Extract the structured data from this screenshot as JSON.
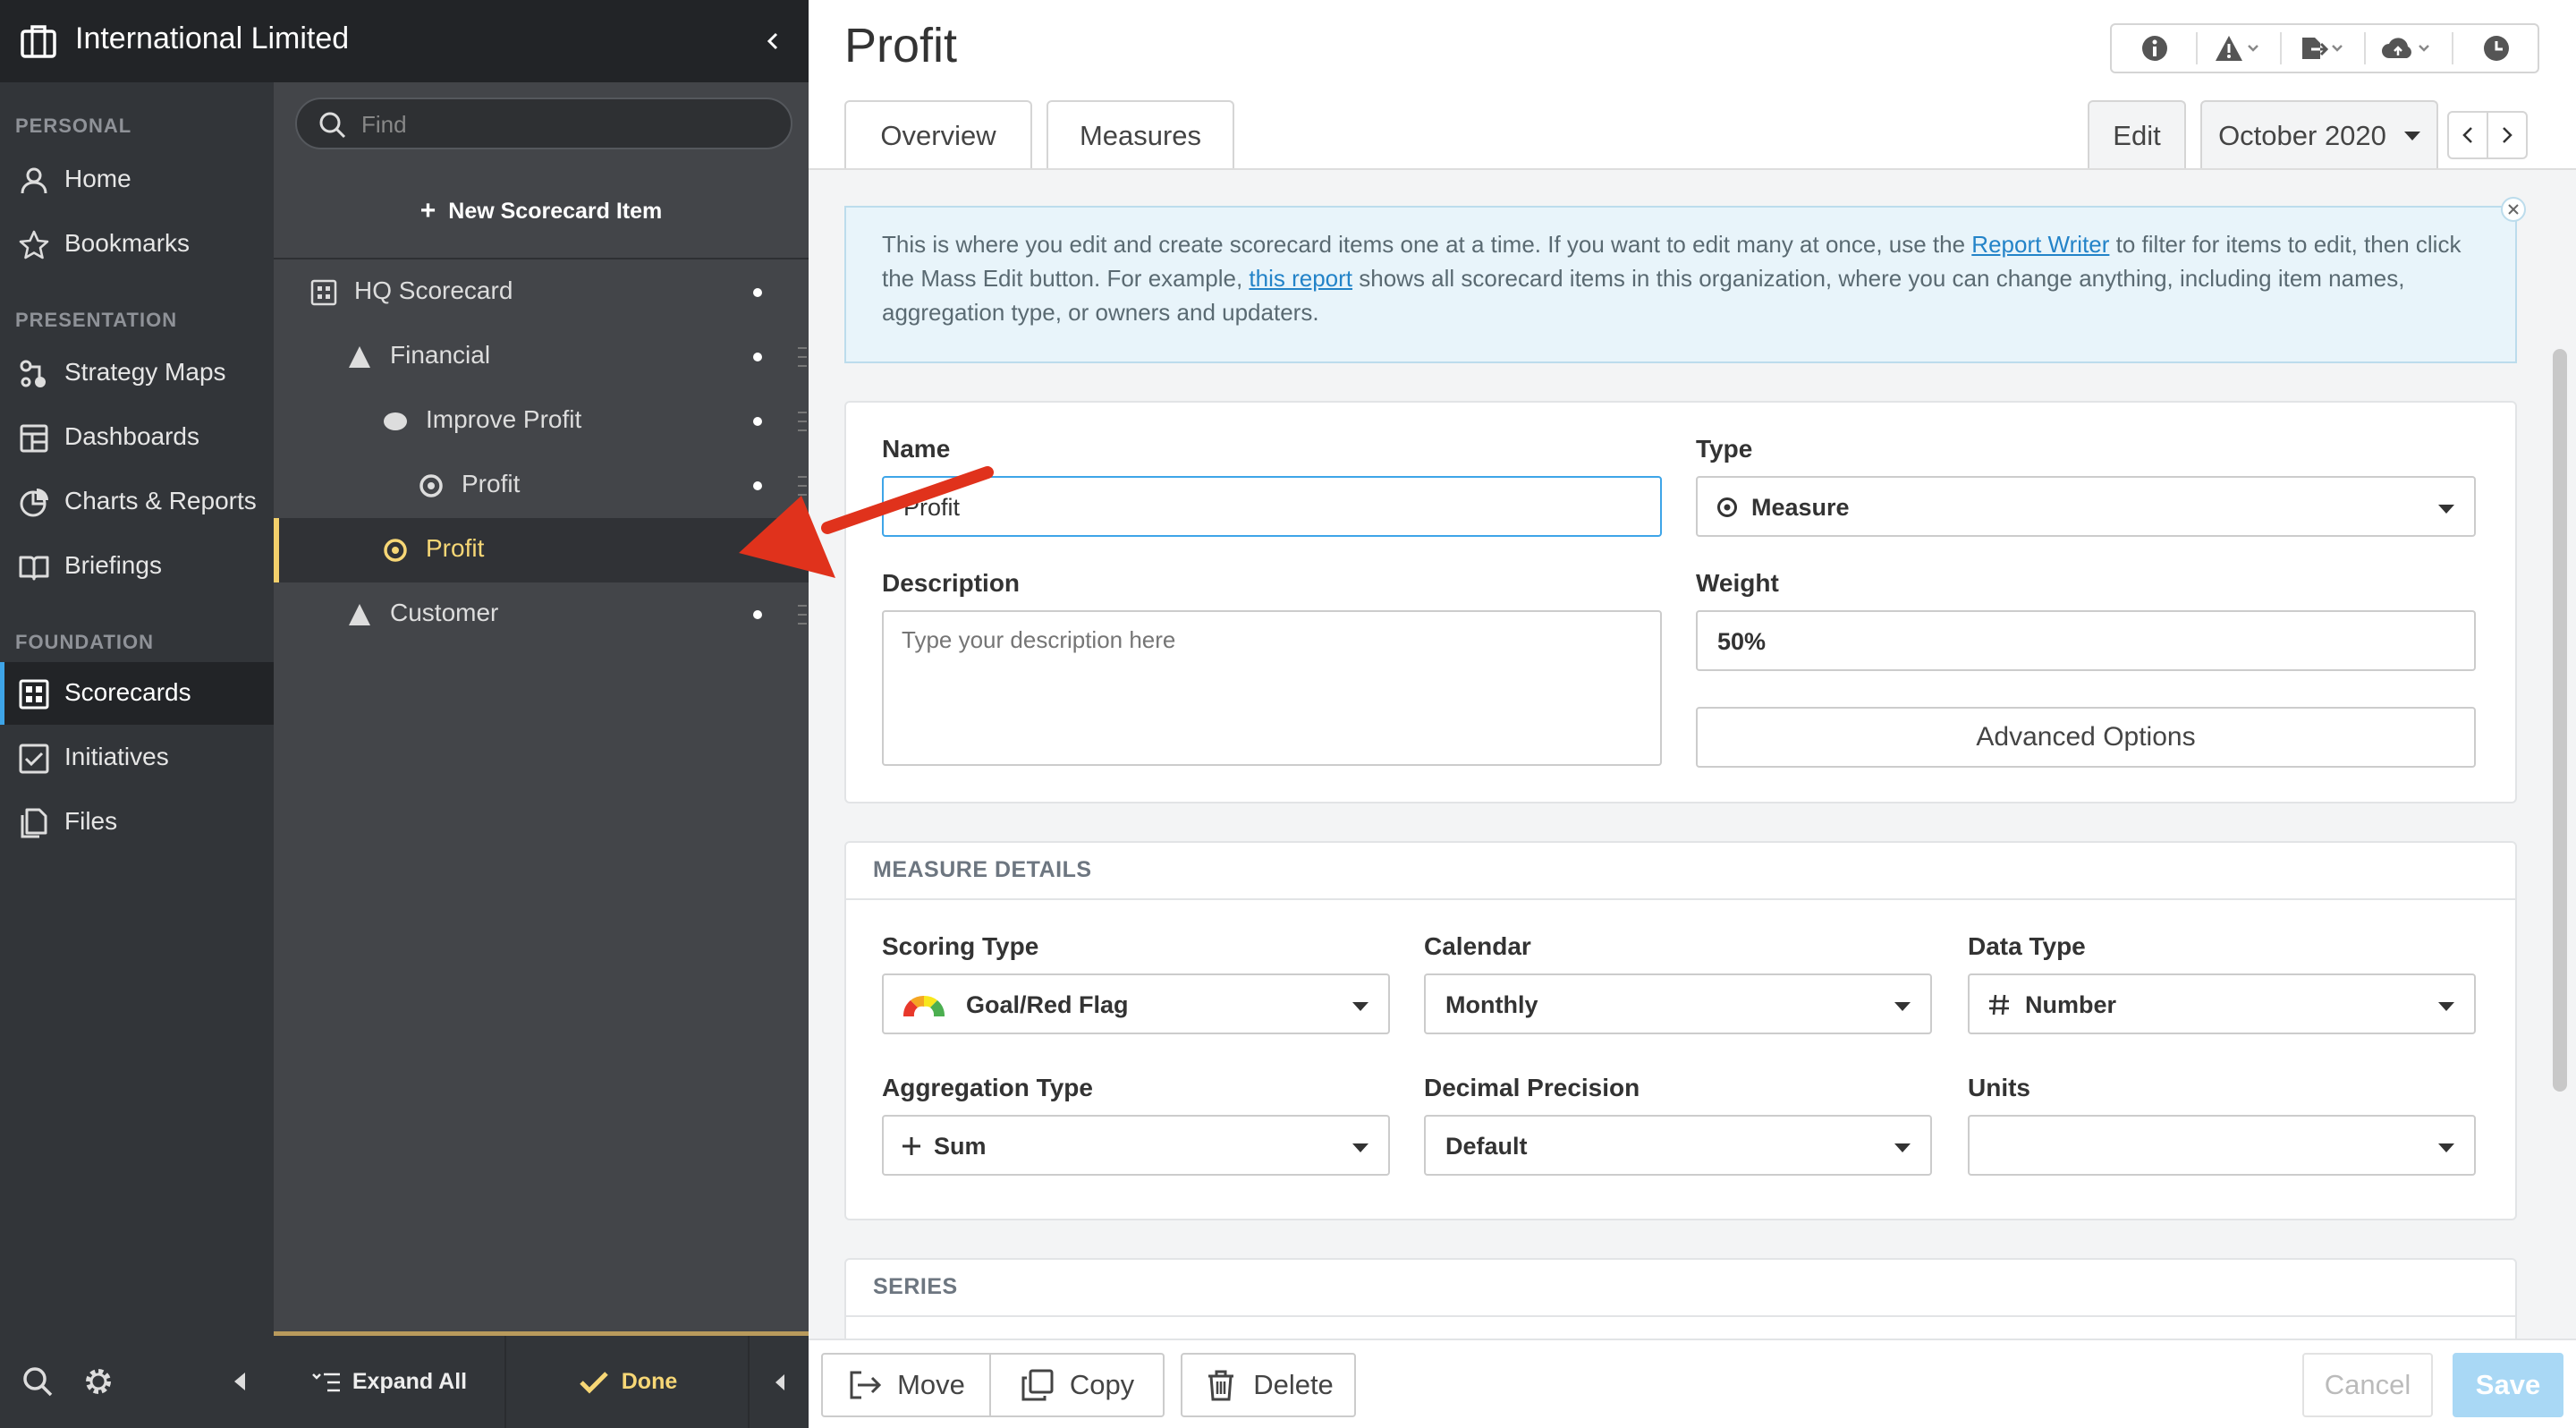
{
  "app": {
    "org_name": "International Limited"
  },
  "sidebar": {
    "sections": [
      {
        "title": "PERSONAL",
        "items": [
          {
            "label": "Home",
            "icon": "user-icon"
          },
          {
            "label": "Bookmarks",
            "icon": "star-icon"
          }
        ]
      },
      {
        "title": "PRESENTATION",
        "items": [
          {
            "label": "Strategy Maps",
            "icon": "strategy-map-icon"
          },
          {
            "label": "Dashboards",
            "icon": "dashboard-icon"
          },
          {
            "label": "Charts & Reports",
            "icon": "pie-chart-icon"
          },
          {
            "label": "Briefings",
            "icon": "book-icon"
          }
        ]
      },
      {
        "title": "FOUNDATION",
        "items": [
          {
            "label": "Scorecards",
            "icon": "scorecard-icon",
            "active": true
          },
          {
            "label": "Initiatives",
            "icon": "checkbox-icon"
          },
          {
            "label": "Files",
            "icon": "files-icon"
          }
        ]
      }
    ]
  },
  "tree": {
    "find_placeholder": "Find",
    "new_item_label": "New Scorecard Item",
    "items": [
      {
        "label": "HQ Scorecard",
        "icon": "scorecard-icon"
      },
      {
        "label": "Financial",
        "icon": "triangle-icon"
      },
      {
        "label": "Improve Profit",
        "icon": "ellipse-icon"
      },
      {
        "label": "Profit",
        "icon": "measure-icon"
      },
      {
        "label": "Profit",
        "icon": "measure-icon",
        "selected": true
      },
      {
        "label": "Customer",
        "icon": "triangle-icon"
      }
    ],
    "expand_all_label": "Expand All",
    "done_label": "Done"
  },
  "header": {
    "title": "Profit",
    "tabs": [
      "Overview",
      "Measures"
    ],
    "edit_tab": "Edit",
    "period": "October 2020"
  },
  "info_box": {
    "part1": "This is where you edit and create scorecard items one at a time. If you want to edit many at once, use the ",
    "link1": "Report Writer",
    "part2": " to filter for items to edit, then click the Mass Edit button. For example, ",
    "link2": "this report",
    "part3": " shows all scorecard items in this organization, where you can change anything, including item names, aggregation type, or owners and updaters."
  },
  "form": {
    "name_label": "Name",
    "name_value": "Profit",
    "type_label": "Type",
    "type_value": "Measure",
    "description_label": "Description",
    "description_placeholder": "Type your description here",
    "weight_label": "Weight",
    "weight_value": "50%",
    "advanced_label": "Advanced Options"
  },
  "measure_details": {
    "title": "MEASURE DETAILS",
    "scoring_type_label": "Scoring Type",
    "scoring_type_value": "Goal/Red Flag",
    "calendar_label": "Calendar",
    "calendar_value": "Monthly",
    "data_type_label": "Data Type",
    "data_type_value": "Number",
    "aggregation_label": "Aggregation Type",
    "aggregation_value": "Sum",
    "decimal_label": "Decimal Precision",
    "decimal_value": "Default",
    "units_label": "Units",
    "units_value": ""
  },
  "series": {
    "title": "SERIES"
  },
  "actions": {
    "move": "Move",
    "copy": "Copy",
    "delete": "Delete",
    "cancel": "Cancel",
    "save": "Save"
  },
  "colors": {
    "accent": "#3ea5e8",
    "selected": "#f3d06b",
    "annotation_arrow": "#e0321c",
    "save_bg": "#a9d8f5"
  }
}
